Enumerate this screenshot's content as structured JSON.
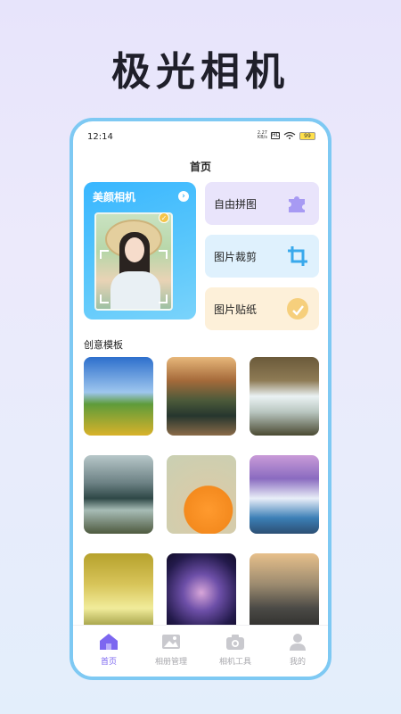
{
  "hero": {
    "title": "极光相机"
  },
  "status": {
    "time": "12:14",
    "net_speed_value": "2.27",
    "net_speed_unit": "KB/s",
    "sim": "HD",
    "battery": "99"
  },
  "page": {
    "title": "首页"
  },
  "feature_cards": {
    "beauty": {
      "label": "美颜相机",
      "icon": "chevron-right-icon"
    },
    "puzzle": {
      "label": "自由拼图",
      "icon": "puzzle-icon"
    },
    "crop": {
      "label": "图片裁剪",
      "icon": "crop-icon"
    },
    "sticker": {
      "label": "图片贴纸",
      "icon": "sticker-icon"
    }
  },
  "templates": {
    "section_title": "创意模板",
    "items": [
      "sunflower-field",
      "lake-reflection",
      "waterfall",
      "seaside-cliff",
      "orange-slice",
      "purple-waterfall",
      "golden-forest",
      "nebula",
      "wooden-pier"
    ]
  },
  "tabbar": {
    "tabs": [
      {
        "label": "首页",
        "icon": "home-icon",
        "active": true
      },
      {
        "label": "相册管理",
        "icon": "image-icon",
        "active": false
      },
      {
        "label": "相机工具",
        "icon": "camera-icon",
        "active": false
      },
      {
        "label": "我的",
        "icon": "user-icon",
        "active": false
      }
    ]
  },
  "colors": {
    "accent": "#7c67f0",
    "frame": "#7ec9f3",
    "beauty_card": "#38b6ff"
  }
}
